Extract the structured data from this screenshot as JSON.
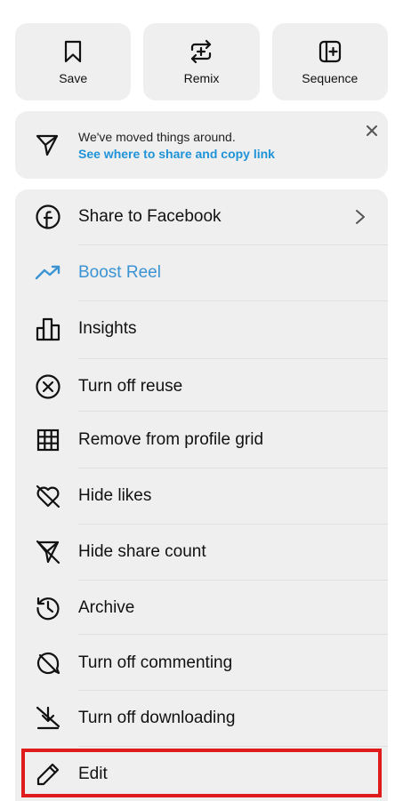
{
  "top_actions": [
    {
      "label": "Save",
      "icon": "bookmark-icon"
    },
    {
      "label": "Remix",
      "icon": "remix-icon"
    },
    {
      "label": "Sequence",
      "icon": "sequence-icon"
    }
  ],
  "notice": {
    "title": "We've moved things around.",
    "link": "See where to share and copy link",
    "icon": "send-icon"
  },
  "menu": {
    "items": [
      {
        "label": "Share to Facebook",
        "icon": "facebook-icon"
      },
      {
        "label": "Boost Reel",
        "icon": "trending-up-icon"
      },
      {
        "label": "Insights",
        "icon": "bar-chart-icon"
      },
      {
        "label": "Turn off reuse",
        "icon": "x-circle-icon"
      },
      {
        "label": "Remove from profile grid",
        "icon": "grid-icon"
      },
      {
        "label": "Hide likes",
        "icon": "heart-off-icon"
      },
      {
        "label": "Hide share count",
        "icon": "send-off-icon"
      },
      {
        "label": "Archive",
        "icon": "archive-history-icon"
      },
      {
        "label": "Turn off commenting",
        "icon": "comment-off-icon"
      },
      {
        "label": "Turn off downloading",
        "icon": "download-off-icon"
      },
      {
        "label": "Edit",
        "icon": "pencil-icon"
      }
    ]
  },
  "colors": {
    "accent": "#3a93d3",
    "link": "#1f93d8",
    "highlight": "#e01b1b",
    "card": "#efefef"
  }
}
